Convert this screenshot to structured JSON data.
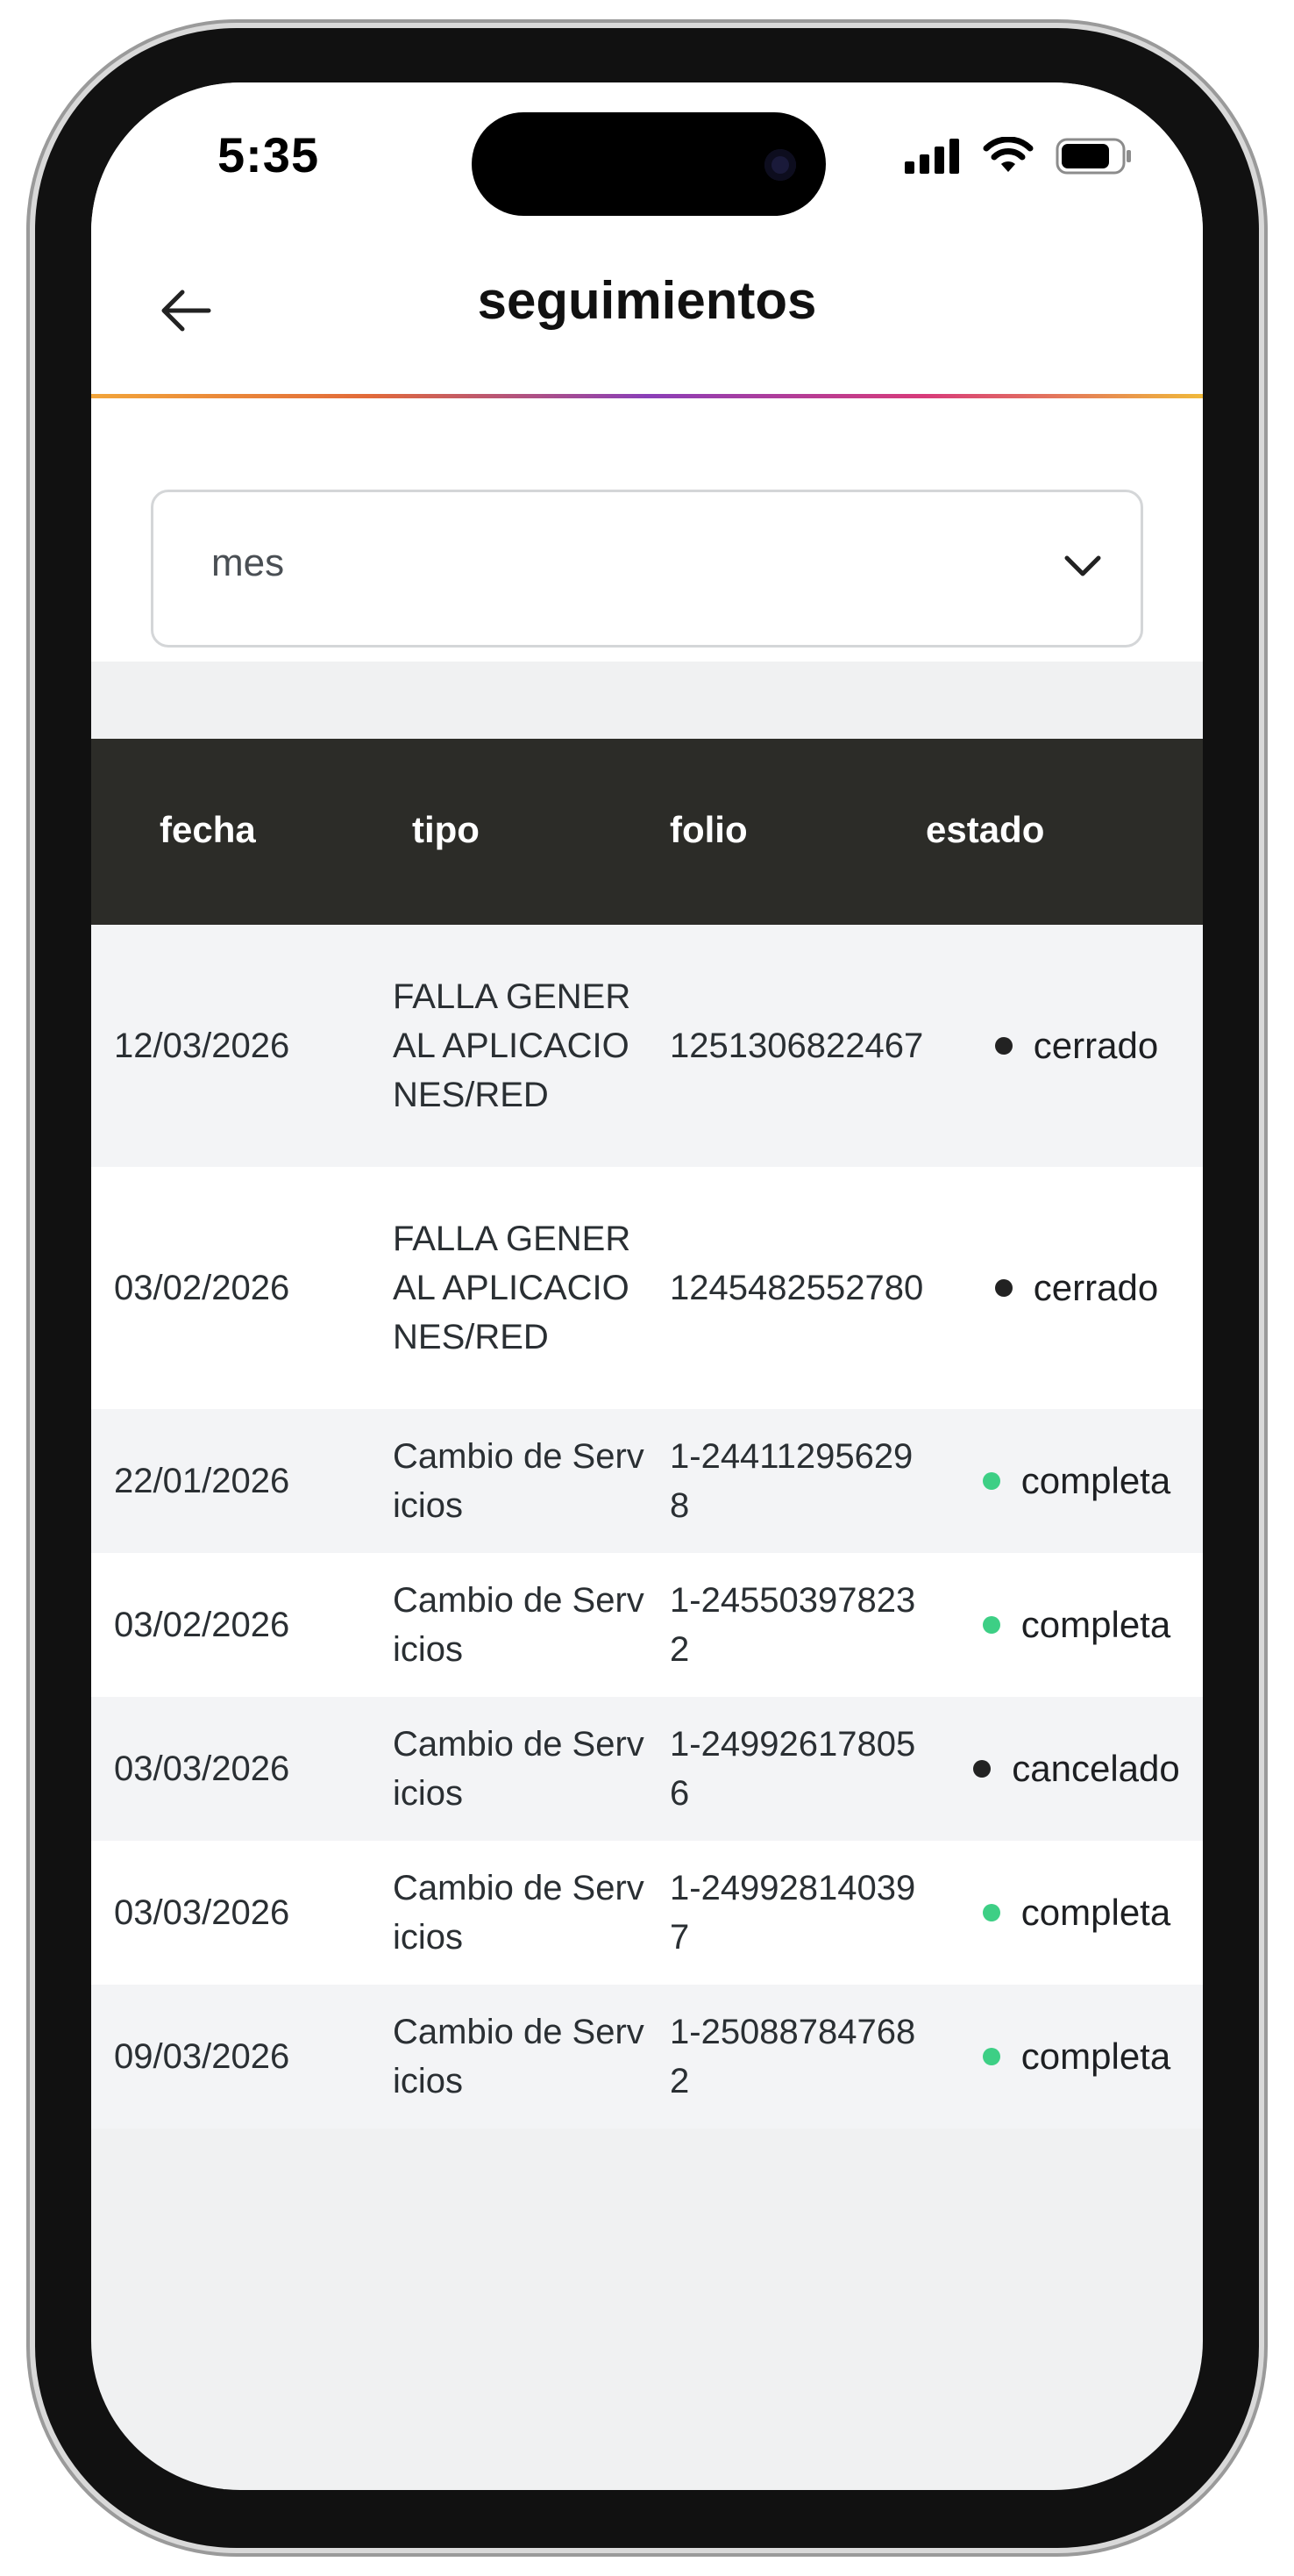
{
  "status_bar": {
    "time": "5:35"
  },
  "header": {
    "title": "seguimientos"
  },
  "filter": {
    "value": "mes"
  },
  "table": {
    "columns": [
      "fecha",
      "tipo",
      "folio",
      "estado"
    ],
    "rows": [
      {
        "fecha": "12/03/2026",
        "tipo": "FALLA GENERAL APLICACIONES/RED",
        "folio": "1251306822467",
        "estado": "cerrado"
      },
      {
        "fecha": "03/02/2026",
        "tipo": "FALLA GENERAL APLICACIONES/RED",
        "folio": "1245482552780",
        "estado": "cerrado"
      },
      {
        "fecha": "22/01/2026",
        "tipo": "Cambio de Servicios",
        "folio": "1-244112956298",
        "estado": "completa"
      },
      {
        "fecha": "03/02/2026",
        "tipo": "Cambio de Servicios",
        "folio": "1-245503978232",
        "estado": "completa"
      },
      {
        "fecha": "03/03/2026",
        "tipo": "Cambio de Servicios",
        "folio": "1-249926178056",
        "estado": "cancelado"
      },
      {
        "fecha": "03/03/2026",
        "tipo": "Cambio de Servicios",
        "folio": "1-249928140397",
        "estado": "completa"
      },
      {
        "fecha": "09/03/2026",
        "tipo": "Cambio de Servicios",
        "folio": "1-250887847682",
        "estado": "completa"
      }
    ]
  },
  "status_colors": {
    "cerrado": "#222222",
    "cancelado": "#222222",
    "completa": "#3dcf85"
  },
  "icons": {
    "back": "arrow-left-icon",
    "select": "chevron-down-icon",
    "signal": "cellular-signal-icon",
    "wifi": "wifi-icon",
    "battery": "battery-icon"
  }
}
